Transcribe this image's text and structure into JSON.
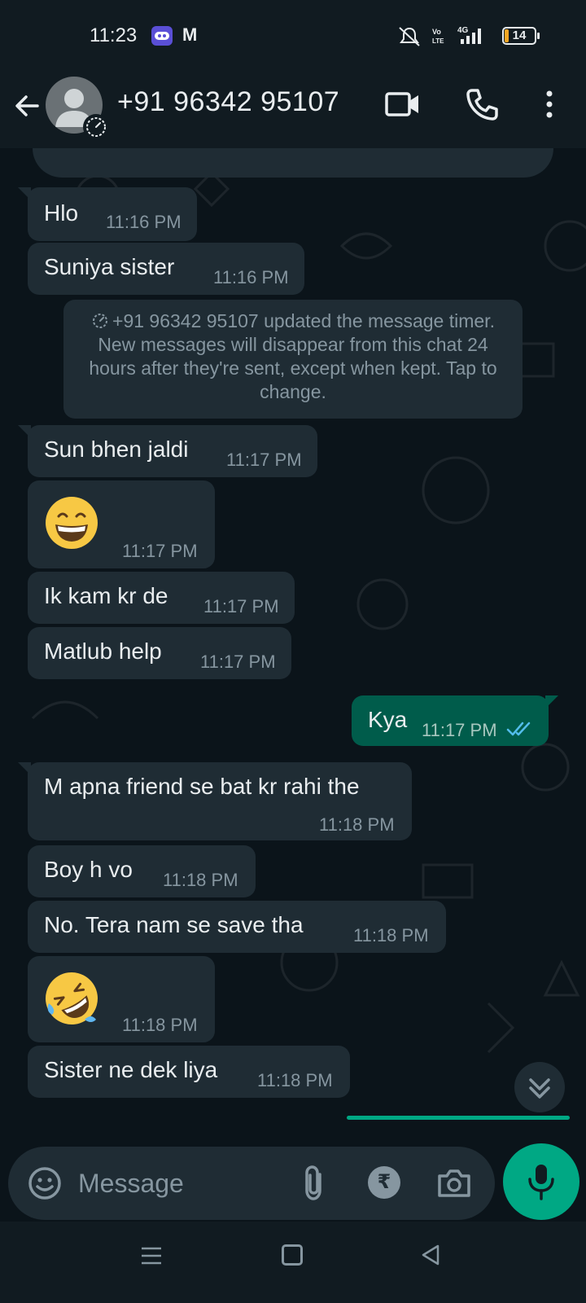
{
  "status_bar": {
    "time": "11:23",
    "app2_label": "M",
    "battery": "14"
  },
  "header": {
    "contact_name": "+91 96342 95107"
  },
  "system_message": "+91 96342 95107 updated the message timer. New messages will disappear from this chat 24 hours after they're sent, except when kept. Tap to change.",
  "messages": [
    {
      "text": "Hlo",
      "time": "11:16 PM",
      "dir": "in"
    },
    {
      "text": "Suniya sister",
      "time": "11:16 PM",
      "dir": "in"
    },
    {
      "text": "Sun bhen jaldi",
      "time": "11:17 PM",
      "dir": "in"
    },
    {
      "text": "",
      "emoji": "grinning-face",
      "time": "11:17 PM",
      "dir": "in"
    },
    {
      "text": "Ik kam kr de",
      "time": "11:17 PM",
      "dir": "in"
    },
    {
      "text": "Matlub help",
      "time": "11:17 PM",
      "dir": "in"
    },
    {
      "text": "Kya",
      "time": "11:17 PM",
      "dir": "out",
      "status": "read"
    },
    {
      "text": "M apna friend se bat kr rahi the",
      "time": "11:18 PM",
      "dir": "in"
    },
    {
      "text": "Boy h vo",
      "time": "11:18 PM",
      "dir": "in"
    },
    {
      "text": "No. Tera nam se save tha",
      "time": "11:18 PM",
      "dir": "in"
    },
    {
      "text": "",
      "emoji": "rolling-on-floor-laughing",
      "time": "11:18 PM",
      "dir": "in"
    },
    {
      "text": "Sister ne dek liya",
      "time": "11:18 PM",
      "dir": "in"
    }
  ],
  "composer": {
    "placeholder": "Message",
    "rupee_symbol": "₹"
  },
  "colors": {
    "background": "#0b141a",
    "header": "#111b21",
    "incoming_bubble": "#1f2c34",
    "outgoing_bubble": "#005c4b",
    "accent": "#00a884",
    "read_ticks": "#53bdeb"
  }
}
